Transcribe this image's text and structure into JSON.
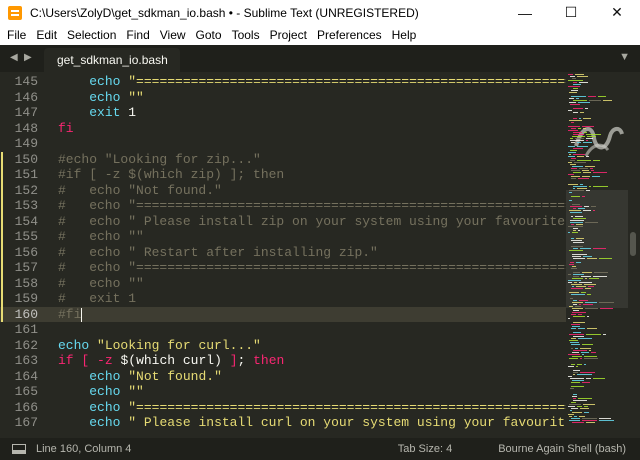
{
  "window": {
    "title": "C:\\Users\\ZolyD\\get_sdkman_io.bash • - Sublime Text (UNREGISTERED)",
    "controls": {
      "minimize": "—",
      "maximize": "☐",
      "close": "✕"
    }
  },
  "menu": [
    "File",
    "Edit",
    "Selection",
    "Find",
    "View",
    "Goto",
    "Tools",
    "Project",
    "Preferences",
    "Help"
  ],
  "tabs": {
    "nav_left": "◀",
    "nav_right": "▶",
    "active": {
      "label": "get_sdkman_io.bash",
      "modified": true
    },
    "overflow": "▼"
  },
  "editor": {
    "current_line": 160,
    "modified_lines": [
      150,
      160
    ],
    "lines": [
      {
        "n": "145",
        "tokens": [
          [
            "t-txt",
            "    "
          ],
          [
            "t-cmd",
            "echo"
          ],
          [
            "t-txt",
            " "
          ],
          [
            "t-str",
            "\"================================================================================================\""
          ]
        ]
      },
      {
        "n": "146",
        "tokens": [
          [
            "t-txt",
            "    "
          ],
          [
            "t-cmd",
            "echo"
          ],
          [
            "t-txt",
            " "
          ],
          [
            "t-str",
            "\"\""
          ]
        ]
      },
      {
        "n": "147",
        "tokens": [
          [
            "t-txt",
            "    "
          ],
          [
            "t-cmd",
            "exit"
          ],
          [
            "t-txt",
            " "
          ],
          [
            "t-txt",
            "1"
          ]
        ]
      },
      {
        "n": "148",
        "tokens": [
          [
            "t-kw",
            "fi"
          ]
        ]
      },
      {
        "n": "149",
        "tokens": []
      },
      {
        "n": "150",
        "tokens": [
          [
            "t-com",
            "#echo \"Looking for zip...\""
          ]
        ]
      },
      {
        "n": "151",
        "tokens": [
          [
            "t-com",
            "#if [ -z $(which zip) ]; then"
          ]
        ]
      },
      {
        "n": "152",
        "tokens": [
          [
            "t-com",
            "#   echo \"Not found.\""
          ]
        ]
      },
      {
        "n": "153",
        "tokens": [
          [
            "t-com",
            "#   echo \"================================================================================================\""
          ]
        ]
      },
      {
        "n": "154",
        "tokens": [
          [
            "t-com",
            "#   echo \" Please install zip on your system using your favourite package manager.\""
          ]
        ]
      },
      {
        "n": "155",
        "tokens": [
          [
            "t-com",
            "#   echo \"\""
          ]
        ]
      },
      {
        "n": "156",
        "tokens": [
          [
            "t-com",
            "#   echo \" Restart after installing zip.\""
          ]
        ]
      },
      {
        "n": "157",
        "tokens": [
          [
            "t-com",
            "#   echo \"================================================================================================\""
          ]
        ]
      },
      {
        "n": "158",
        "tokens": [
          [
            "t-com",
            "#   echo \"\""
          ]
        ]
      },
      {
        "n": "159",
        "tokens": [
          [
            "t-com",
            "#   exit 1"
          ]
        ]
      },
      {
        "n": "160",
        "tokens": [
          [
            "t-com",
            "#fi"
          ]
        ]
      },
      {
        "n": "161",
        "tokens": []
      },
      {
        "n": "162",
        "tokens": [
          [
            "t-cmd",
            "echo"
          ],
          [
            "t-txt",
            " "
          ],
          [
            "t-str",
            "\"Looking for curl...\""
          ]
        ]
      },
      {
        "n": "163",
        "tokens": [
          [
            "t-kw",
            "if"
          ],
          [
            "t-txt",
            " "
          ],
          [
            "t-kw",
            "["
          ],
          [
            "t-txt",
            " "
          ],
          [
            "t-kw",
            "-z"
          ],
          [
            "t-txt",
            " $("
          ],
          [
            "t-txt",
            "which curl"
          ],
          [
            "t-txt",
            ") "
          ],
          [
            "t-kw",
            "]"
          ],
          [
            "t-txt",
            "; "
          ],
          [
            "t-kw",
            "then"
          ]
        ]
      },
      {
        "n": "164",
        "tokens": [
          [
            "t-txt",
            "    "
          ],
          [
            "t-cmd",
            "echo"
          ],
          [
            "t-txt",
            " "
          ],
          [
            "t-str",
            "\"Not found.\""
          ]
        ]
      },
      {
        "n": "165",
        "tokens": [
          [
            "t-txt",
            "    "
          ],
          [
            "t-cmd",
            "echo"
          ],
          [
            "t-txt",
            " "
          ],
          [
            "t-str",
            "\"\""
          ]
        ]
      },
      {
        "n": "166",
        "tokens": [
          [
            "t-txt",
            "    "
          ],
          [
            "t-cmd",
            "echo"
          ],
          [
            "t-txt",
            " "
          ],
          [
            "t-str",
            "\"================================================================================================\""
          ]
        ]
      },
      {
        "n": "167",
        "tokens": [
          [
            "t-txt",
            "    "
          ],
          [
            "t-cmd",
            "echo"
          ],
          [
            "t-txt",
            " "
          ],
          [
            "t-str",
            "\" Please install curl on your system using your favourite package manager.\""
          ]
        ]
      }
    ]
  },
  "minimap": {
    "colors": [
      "#e6db74",
      "#66d9ef",
      "#f92672",
      "#75715e",
      "#f8f8f2",
      "#a6e22e"
    ]
  },
  "status": {
    "position": "Line 160, Column 4",
    "tab_size": "Tab Size: 4",
    "syntax": "Bourne Again Shell (bash)"
  }
}
